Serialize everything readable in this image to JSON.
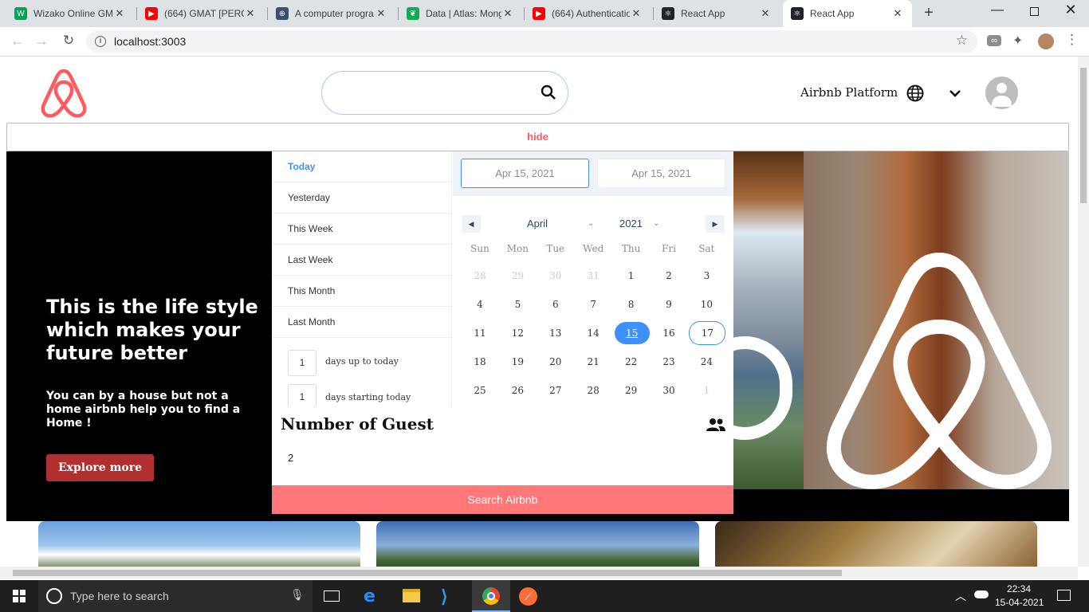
{
  "browser": {
    "tabs": [
      {
        "label": "Wizako Online GM",
        "icon_color": "#0f9d58",
        "icon": "wizako-icon",
        "glyph": "W"
      },
      {
        "label": "(664) GMAT [PERC",
        "icon_color": "#ff0000",
        "icon": "youtube-icon",
        "glyph": "▶"
      },
      {
        "label": "A computer progra",
        "icon_color": "#3b4f6b",
        "icon": "globe-icon",
        "glyph": "⊕"
      },
      {
        "label": "Data | Atlas: Mong",
        "icon_color": "#13aa52",
        "icon": "mongodb-leaf-icon",
        "glyph": "❦"
      },
      {
        "label": "(664) Authenticatio",
        "icon_color": "#ff0000",
        "icon": "youtube-icon",
        "glyph": "▶"
      },
      {
        "label": "React App",
        "icon_color": "#20232a",
        "icon": "react-icon",
        "glyph": "⚛"
      },
      {
        "label": "React App",
        "icon_color": "#20232a",
        "icon": "react-icon",
        "glyph": "⚛"
      }
    ],
    "url": "localhost:3003"
  },
  "header": {
    "brand_color": "#ff5a5f",
    "platform_label": "Airbnb Platform"
  },
  "hide_label": "hide",
  "hero": {
    "title": "This is the life style which makes your future better",
    "subtitle": "You can by a house but not a home airbnb help you to find a Home !",
    "button_label": "Explore more",
    "button_color": "#b22f2f"
  },
  "date_picker": {
    "start_date": "Apr 15, 2021",
    "end_date": "Apr 15, 2021",
    "presets": [
      "Today",
      "Yesterday",
      "This Week",
      "Last Week",
      "This Month",
      "Last Month"
    ],
    "days_up_value": "1",
    "days_up_label": "days up to today",
    "days_start_value": "1",
    "days_start_label": "days starting today",
    "month": "April",
    "year": "2021",
    "weekdays": [
      "Sun",
      "Mon",
      "Tue",
      "Wed",
      "Thu",
      "Fri",
      "Sat"
    ],
    "weeks": [
      [
        "28",
        "29",
        "30",
        "31",
        "1",
        "2",
        "3"
      ],
      [
        "4",
        "5",
        "6",
        "7",
        "8",
        "9",
        "10"
      ],
      [
        "11",
        "12",
        "13",
        "14",
        "15",
        "16",
        "17"
      ],
      [
        "18",
        "19",
        "20",
        "21",
        "22",
        "23",
        "24"
      ],
      [
        "25",
        "26",
        "27",
        "28",
        "29",
        "30",
        "1"
      ]
    ],
    "selected_day": "15",
    "today_day": "17",
    "accent_color": "#3d91ff"
  },
  "guests": {
    "title": "Number of Guest",
    "value": "2"
  },
  "search_button_label": "Search Airbnb",
  "search_button_color": "#ff7779",
  "taskbar": {
    "search_placeholder": "Type here to search",
    "time": "22:34",
    "date": "15-04-2021"
  }
}
